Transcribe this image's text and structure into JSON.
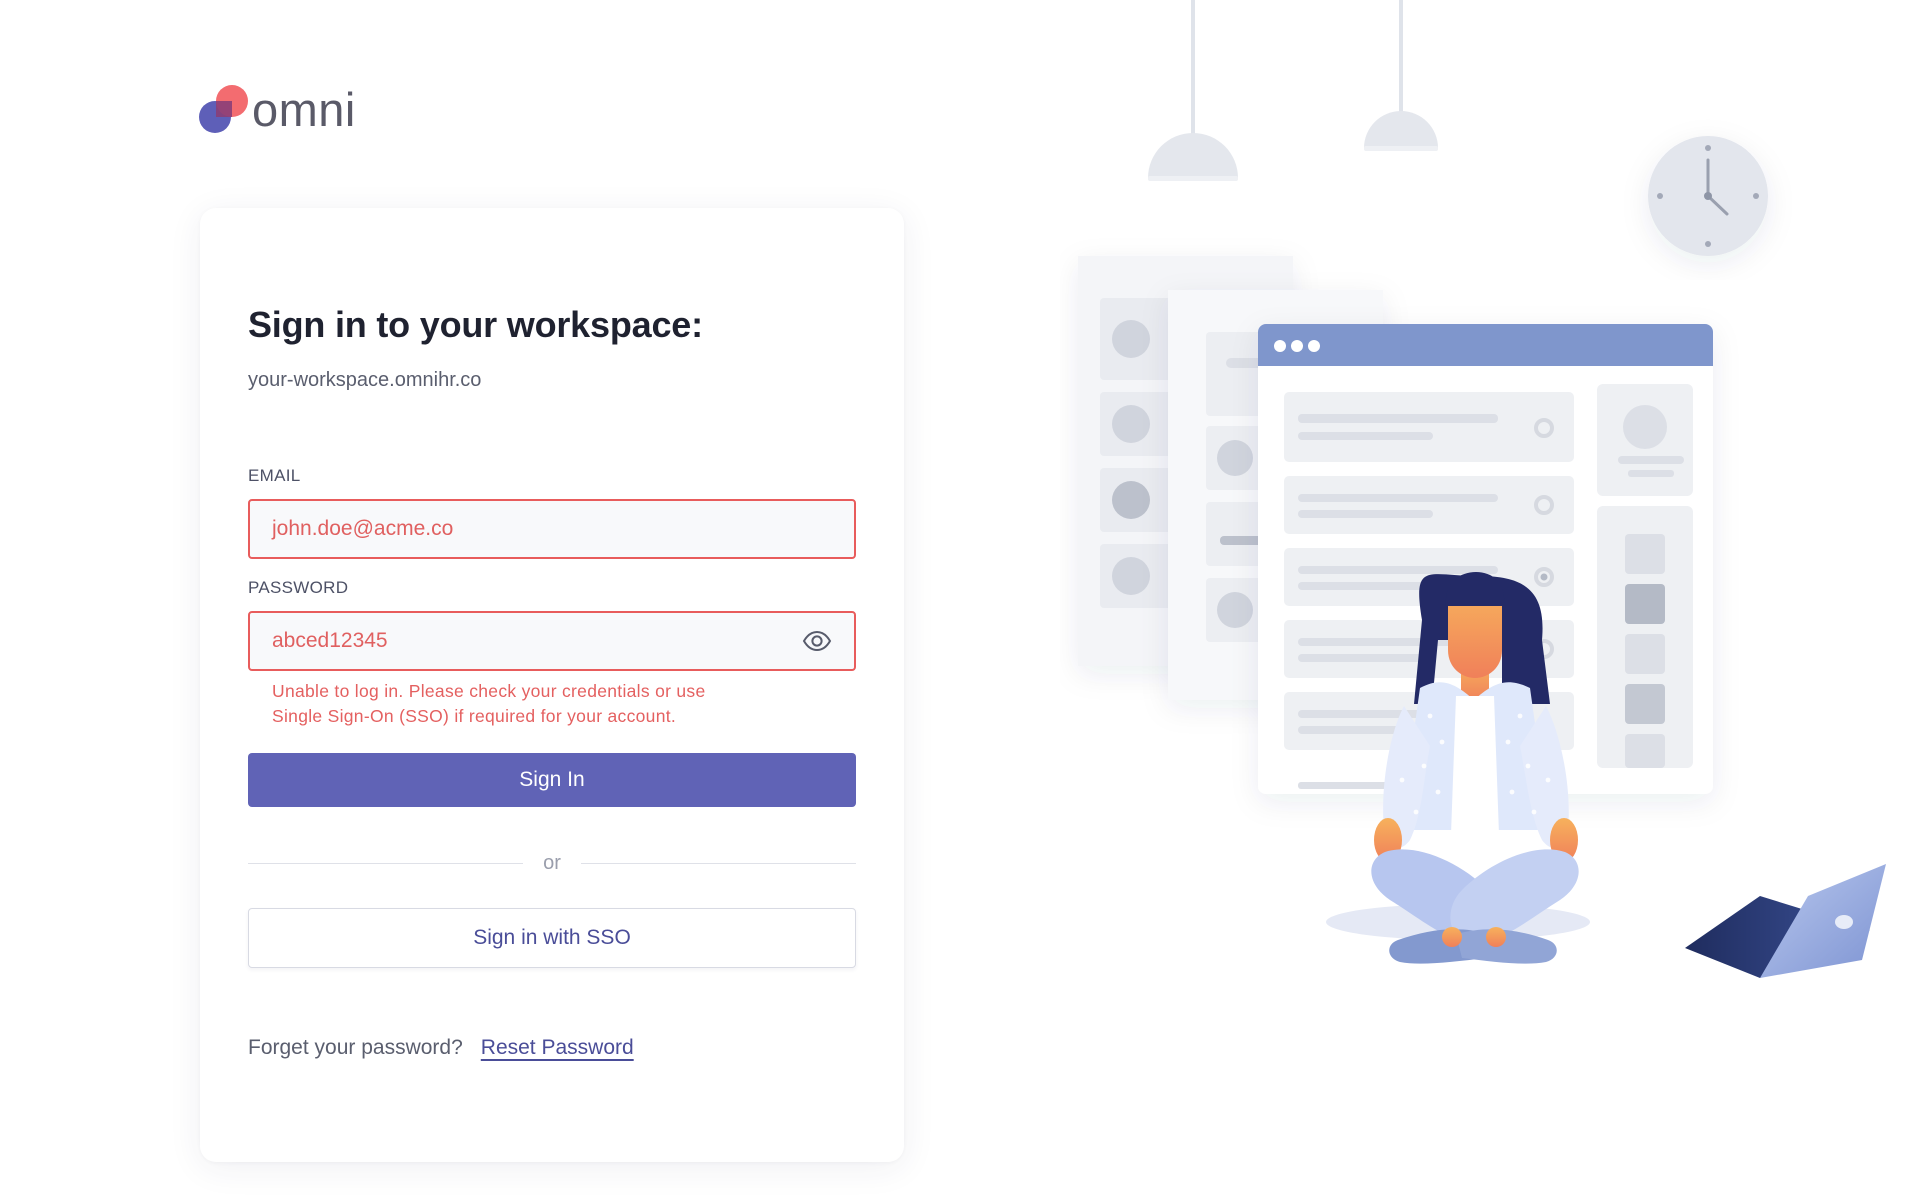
{
  "brand": {
    "name": "omni",
    "color_primary": "#6063b6",
    "color_accent": "#f06a6a"
  },
  "signin": {
    "title": "Sign in to your workspace:",
    "workspace_url": "your-workspace.omnihr.co",
    "email": {
      "label": "EMAIL",
      "value": "john.doe@acme.co"
    },
    "password": {
      "label": "PASSWORD",
      "value": "abced12345",
      "toggle_icon": "eye-icon"
    },
    "error_line1": "Unable to log in. Please check your credentials or use",
    "error_line2": "Single Sign-On (SSO) if required for your account.",
    "sign_in_label": "Sign In",
    "divider_text": "or",
    "sso_label": "Sign in with SSO",
    "forgot_text": "Forget your password?",
    "reset_label": "Reset Password"
  },
  "colors": {
    "error": "#e85c5c",
    "window_header": "#7f96cc"
  }
}
